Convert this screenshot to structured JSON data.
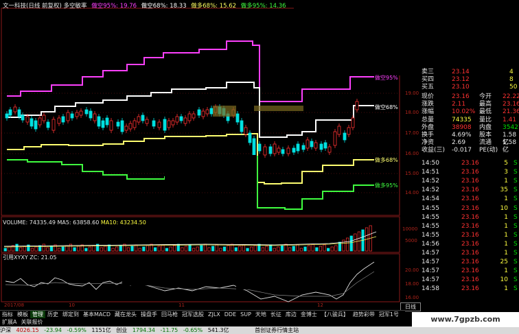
{
  "header": {
    "title": "文一科技(日线 前复权) 多空敏率",
    "items": [
      {
        "label": "做空95%: 19.76",
        "color": "#ff40ff"
      },
      {
        "label": "做空68%: 18.33",
        "color": "#ffffff"
      },
      {
        "label": "做多68%: 15.62",
        "color": "#ffff60"
      },
      {
        "label": "做多95%: 14.36",
        "color": "#40ff40"
      }
    ]
  },
  "band_labels": {
    "short95": "做空95%",
    "short68": "做空68%",
    "long68": "做多68%",
    "long95": "做多95%"
  },
  "price_axis": [
    "19.00",
    "18.00",
    "17.00",
    "16.00",
    "15.00",
    "14.00"
  ],
  "volume": {
    "label": "VOLUME: 74335.49",
    "ma5": "MA5: 63858.60",
    "ma10": "MA10: 43234.50",
    "axis": [
      "10000",
      "5000"
    ]
  },
  "indicator": {
    "label": "引用XYXY",
    "zc": "ZC: 21.05",
    "axis": [
      "20.00",
      "18.00",
      "16.00"
    ]
  },
  "date_axis": [
    "2017/08",
    "10",
    "11",
    "12"
  ],
  "quote": {
    "order_rows": [
      {
        "label": "卖三",
        "price": "23.14",
        "vol": "4"
      },
      {
        "label": "买四",
        "price": "23.12",
        "vol": "8"
      },
      {
        "label": "买五",
        "price": "23.10",
        "vol": "50"
      }
    ],
    "rows": [
      {
        "l1": "现价",
        "v1": "23.16",
        "l2": "今开",
        "v2": "22.22",
        "c1": "rise",
        "c2": "rise"
      },
      {
        "l1": "涨跌",
        "v1": "2.11",
        "l2": "最高",
        "v2": "23.16",
        "c1": "rise",
        "c2": "rise"
      },
      {
        "l1": "涨幅",
        "v1": "10.02%",
        "l2": "最低",
        "v2": "21.36",
        "c1": "rise",
        "c2": "rise"
      },
      {
        "l1": "总量",
        "v1": "74335",
        "l2": "量比",
        "v2": "1.41",
        "c1": "yel",
        "c2": "rise"
      },
      {
        "l1": "外盘",
        "v1": "38908",
        "l2": "内盘",
        "v2": "35427",
        "c1": "rise",
        "c2": "fall"
      },
      {
        "l1": "换手",
        "v1": "4.69%",
        "l2": "股本",
        "v2": "1.58亿",
        "c1": "white",
        "c2": "white"
      },
      {
        "l1": "净资",
        "v1": "2.69",
        "l2": "流通",
        "v2": "1.58亿",
        "c1": "white",
        "c2": "white"
      },
      {
        "l1": "收益(三)",
        "v1": "-0.017",
        "l2": "PE(动)",
        "v2": "-",
        "c1": "white",
        "c2": "white"
      }
    ],
    "ticks": [
      {
        "time": "14:50",
        "price": "23.16",
        "vol": "5",
        "side": "S"
      },
      {
        "time": "14:51",
        "price": "23.16",
        "vol": "3",
        "side": "S"
      },
      {
        "time": "14:52",
        "price": "23.16",
        "vol": "1",
        "side": "S"
      },
      {
        "time": "14:52",
        "price": "23.16",
        "vol": "35",
        "side": "S"
      },
      {
        "time": "14:54",
        "price": "23.16",
        "vol": "1",
        "side": "S"
      },
      {
        "time": "14:55",
        "price": "23.16",
        "vol": "10",
        "side": "S"
      },
      {
        "time": "14:55",
        "price": "23.16",
        "vol": "1",
        "side": "S"
      },
      {
        "time": "14:55",
        "price": "23.16",
        "vol": "1",
        "side": "S"
      },
      {
        "time": "14:55",
        "price": "23.16",
        "vol": "1",
        "side": "S"
      },
      {
        "time": "14:56",
        "price": "23.16",
        "vol": "1",
        "side": "S"
      },
      {
        "time": "14:57",
        "price": "23.16",
        "vol": "1",
        "side": "S"
      },
      {
        "time": "14:57",
        "price": "23.16",
        "vol": "25",
        "side": "S"
      },
      {
        "time": "14:57",
        "price": "23.16",
        "vol": "1",
        "side": "S"
      },
      {
        "time": "14:57",
        "price": "23.16",
        "vol": "10",
        "side": "S"
      },
      {
        "time": "14:58",
        "price": "23.16",
        "vol": "1",
        "side": "S"
      }
    ]
  },
  "tabs": [
    "指标",
    "模板",
    "管理",
    "历史",
    "绑定到",
    "基本MACD",
    "藏在龙头",
    "操盘手",
    "回马枪",
    "冠军选股",
    "ZJLX",
    "DDE",
    "SUP",
    "天地",
    "长征",
    "库边",
    "金博士",
    "【八骏兵】",
    "趋势彩带",
    "冠军1号"
  ],
  "active_tab": "管理",
  "tab_extra": [
    "扩展A",
    "关联报价"
  ],
  "day_tab": "日线",
  "status_bar": {
    "sh_label": "沪深",
    "sh_value": "4026.15",
    "sh_change": "-23.94",
    "sh_pct": "-0.59%",
    "sh_amount": "1151亿",
    "cy_label": "创业",
    "cy_value": "1794.34",
    "cy_change": "-11.75",
    "cy_pct": "-0.65%",
    "cy_amount": "541.3亿",
    "ticker": "首创证券行情主站"
  },
  "watermark": "www.7gpzb.com",
  "colors": {
    "rise": "#ff3232",
    "fall": "#00e0e0",
    "short95": "#ff40ff",
    "short68": "#ffffff",
    "long68": "#ffff70",
    "long95": "#40ff40",
    "grid": "#8b1a1a"
  }
}
